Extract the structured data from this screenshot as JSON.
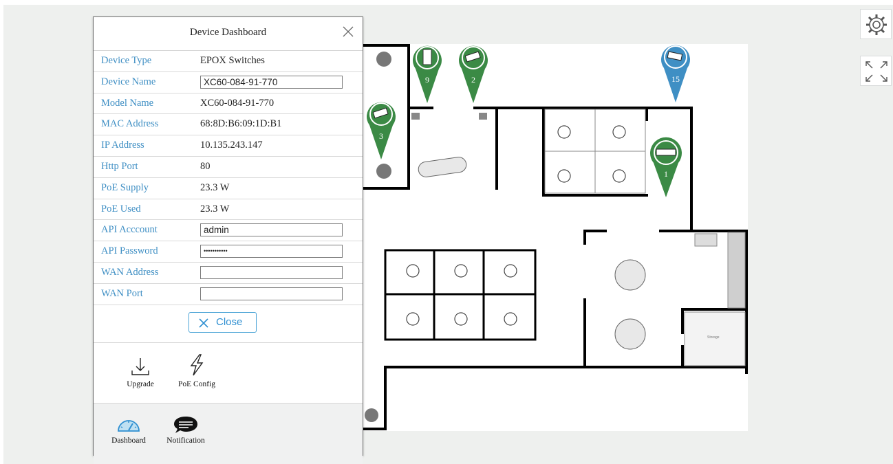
{
  "dialog": {
    "title": "Device Dashboard",
    "fields": [
      {
        "label": "Device Type",
        "value": "EPOX Switches",
        "input": false
      },
      {
        "label": "Device Name",
        "value": "XC60-084-91-770",
        "input": true
      },
      {
        "label": "Model Name",
        "value": "XC60-084-91-770",
        "input": false
      },
      {
        "label": "MAC Address",
        "value": "68:8D:B6:09:1D:B1",
        "input": false
      },
      {
        "label": "IP Address",
        "value": "10.135.243.147",
        "input": false
      },
      {
        "label": "Http Port",
        "value": "80",
        "input": false
      },
      {
        "label": "PoE Supply",
        "value": "23.3 W",
        "input": false
      },
      {
        "label": "PoE Used",
        "value": "23.3 W",
        "input": false
      },
      {
        "label": "API Acccount",
        "value": "admin",
        "input": true
      },
      {
        "label": "API Password",
        "value": "•••••••••••",
        "input": true
      },
      {
        "label": "WAN Address",
        "value": "",
        "input": true
      },
      {
        "label": "WAN Port",
        "value": "",
        "input": true
      }
    ],
    "close_label": "Close",
    "tools": [
      {
        "label": "Upgrade",
        "icon": "download-icon"
      },
      {
        "label": "PoE Config",
        "icon": "lightning-icon"
      }
    ],
    "footer": [
      {
        "label": "Dashboard",
        "icon": "speedometer-icon"
      },
      {
        "label": "Notification",
        "icon": "chat-bubble-icon"
      }
    ]
  },
  "markers": [
    {
      "number": "9",
      "device": "switch-rack",
      "color": "#3b8a45"
    },
    {
      "number": "2",
      "device": "camera",
      "color": "#3b8a45"
    },
    {
      "number": "3",
      "device": "camera",
      "color": "#3b8a45"
    },
    {
      "number": "15",
      "device": "camera",
      "color": "#3f8fc4"
    },
    {
      "number": "1",
      "device": "network-switch",
      "color": "#3b8a45"
    }
  ],
  "floorplan": {
    "storage_label": "Storage"
  },
  "controls": {
    "settings_icon": "gear-icon",
    "fullscreen_icon": "expand-icon"
  }
}
